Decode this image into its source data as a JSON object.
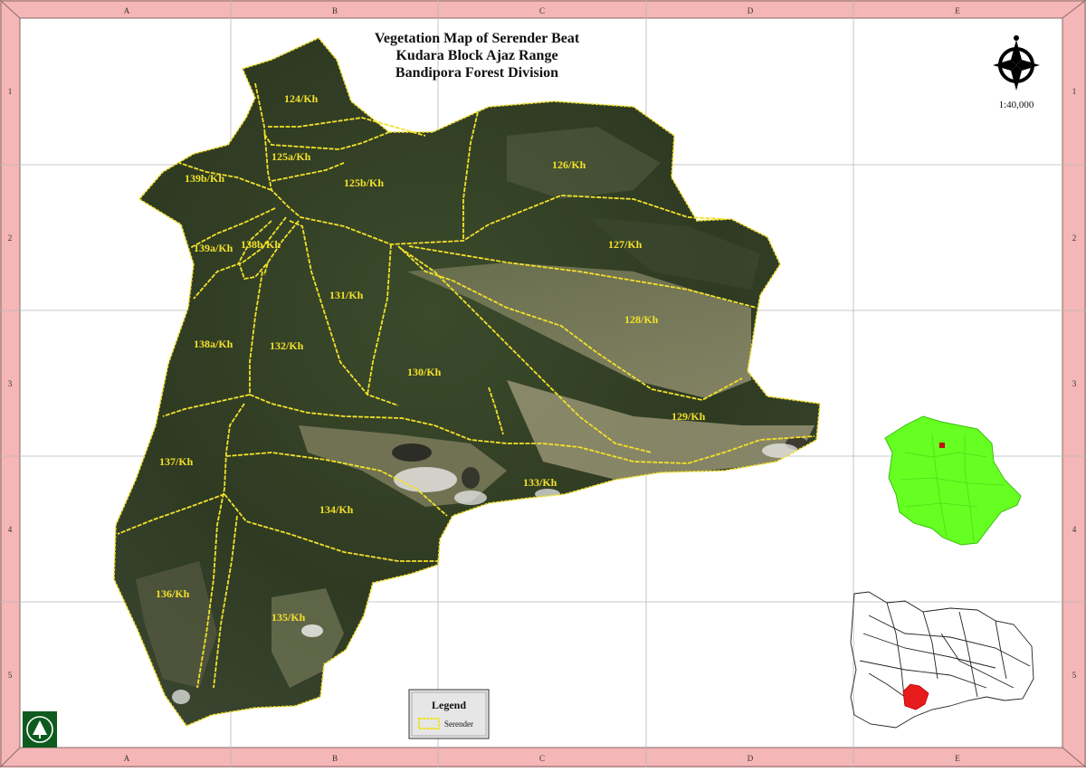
{
  "map": {
    "title_lines": [
      "Vegetation Map of Serender Beat",
      "Kudara Block   Ajaz Range",
      "Bandipora Forest Division"
    ],
    "scale": "1:40,000",
    "grid": {
      "columns": [
        "A",
        "B",
        "C",
        "D",
        "E"
      ],
      "rows": [
        "1",
        "2",
        "3",
        "4",
        "5"
      ]
    },
    "compartments": [
      "124/Kh",
      "125a/Kh",
      "125b/Kh",
      "126/Kh",
      "127/Kh",
      "128/Kh",
      "129/Kh",
      "130/Kh",
      "131/Kh",
      "132/Kh",
      "133/Kh",
      "134/Kh",
      "135/Kh",
      "136/Kh",
      "137/Kh",
      "138a/Kh",
      "138b/Kh",
      "139a/Kh",
      "139b/Kh"
    ],
    "legend": {
      "title": "Legend",
      "item_label": "Serender"
    },
    "colors": {
      "frame_band": "#f4b6b6",
      "boundary": "#f2e12a",
      "label": "#f2e12a",
      "terrain_dark": "#2e3a22",
      "terrain_light": "#b8ad8c",
      "district_fill": "#66ff22",
      "highlight": "#e81c1c"
    },
    "icons": [
      "north-arrow-icon",
      "forest-department-logo-icon"
    ]
  }
}
